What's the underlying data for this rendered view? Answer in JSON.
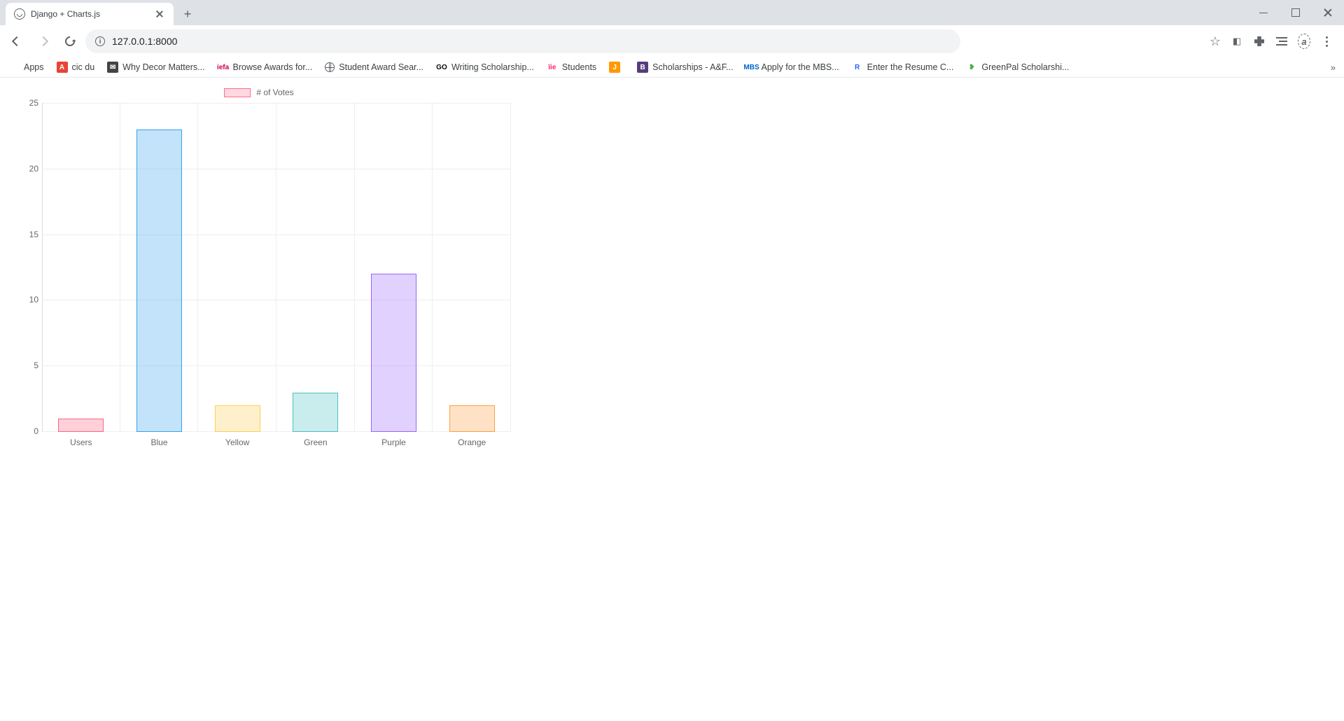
{
  "browser": {
    "tab_title": "Django + Charts.js",
    "url": "127.0.0.1:8000",
    "bookmarks": [
      {
        "label": "Apps",
        "icon": "apps"
      },
      {
        "label": "cic du",
        "icon_bg": "#e94435",
        "icon_fg": "#fff",
        "icon_text": "A"
      },
      {
        "label": "Why Decor Matters...",
        "icon_bg": "#444",
        "icon_fg": "#fff",
        "icon_text": "✉"
      },
      {
        "label": "Browse Awards for...",
        "icon_bg": "#fff",
        "icon_fg": "#c05",
        "icon_text": "iefa"
      },
      {
        "label": "Student Award Sear...",
        "icon": "globe"
      },
      {
        "label": "Writing Scholarship...",
        "icon_bg": "#fff",
        "icon_fg": "#000",
        "icon_text": "GO"
      },
      {
        "label": "Students",
        "icon_bg": "#fff",
        "icon_fg": "#f26",
        "icon_text": "ïie"
      },
      {
        "label": "",
        "icon_bg": "#f90",
        "icon_fg": "#fff",
        "icon_text": "J"
      },
      {
        "label": "Scholarships - A&F...",
        "icon_bg": "#563d7c",
        "icon_fg": "#fff",
        "icon_text": "B"
      },
      {
        "label": "Apply for the MBS...",
        "icon_bg": "#fff",
        "icon_fg": "#06c",
        "icon_text": "MBS"
      },
      {
        "label": "Enter the Resume C...",
        "icon_bg": "#fff",
        "icon_fg": "#2962ff",
        "icon_text": "R"
      },
      {
        "label": "GreenPal Scholarshi...",
        "icon_bg": "#fff",
        "icon_fg": "#4caf50",
        "icon_text": "❥"
      }
    ]
  },
  "chart_data": {
    "type": "bar",
    "legend": "# of Votes",
    "categories": [
      "Users",
      "Blue",
      "Yellow",
      "Green",
      "Purple",
      "Orange"
    ],
    "values": [
      1,
      23,
      2,
      3,
      12,
      2
    ],
    "ylim": [
      0,
      25
    ],
    "yticks": [
      0,
      5,
      10,
      15,
      20,
      25
    ],
    "colors_fill": [
      "rgba(255,99,132,0.3)",
      "rgba(54,162,235,0.3)",
      "rgba(255,206,86,0.3)",
      "rgba(75,192,192,0.3)",
      "rgba(153,102,255,0.3)",
      "rgba(255,159,64,0.3)"
    ],
    "colors_border": [
      "rgba(255,99,132,1)",
      "rgba(54,162,235,1)",
      "rgba(255,206,86,1)",
      "rgba(75,192,192,1)",
      "rgba(153,102,255,1)",
      "rgba(255,159,64,1)"
    ]
  }
}
